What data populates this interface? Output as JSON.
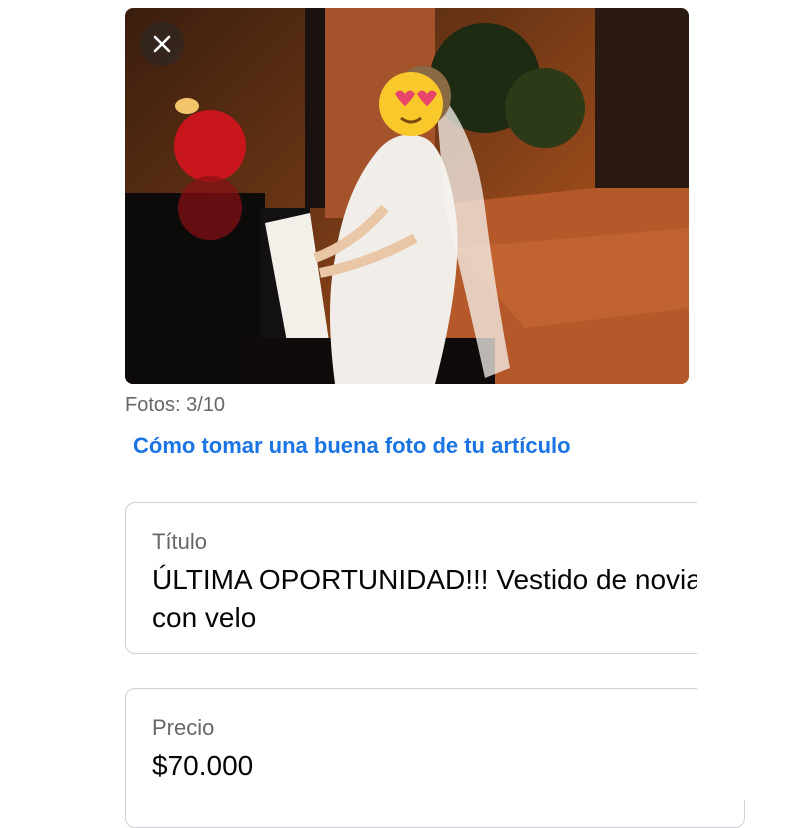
{
  "photo": {
    "alt_icon": "wedding-dress-photo",
    "counter": "Fotos: 3/10"
  },
  "close_icon": "close-icon",
  "tip_link": "Cómo tomar una buena foto de tu artículo",
  "fields": {
    "title": {
      "label": "Título",
      "value": "ÚLTIMA OPORTUNIDAD!!! Vestido de novia con velo"
    },
    "price": {
      "label": "Precio",
      "value": "$70.000"
    }
  },
  "colors": {
    "link": "#1b74e4",
    "secondary_text": "#65676b",
    "border": "#ced0d4"
  }
}
